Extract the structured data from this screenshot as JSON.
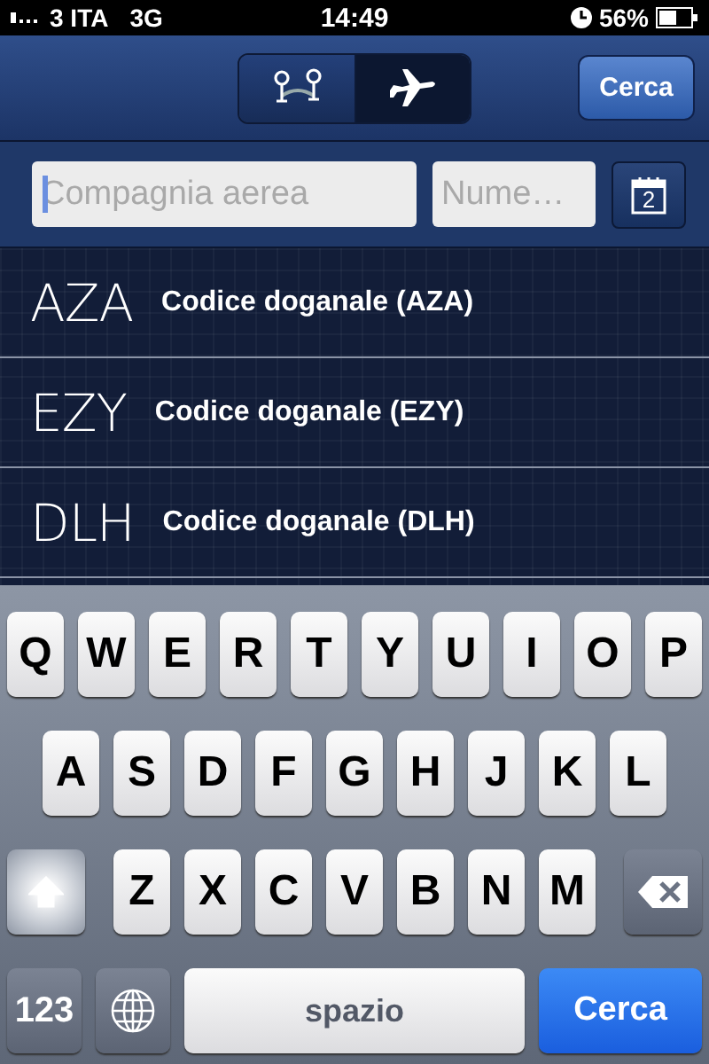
{
  "status_bar": {
    "carrier": "3 ITA",
    "network": "3G",
    "time": "14:49",
    "battery": "56%"
  },
  "nav_bar": {
    "segments": [
      {
        "kind": "route",
        "selected": false
      },
      {
        "kind": "plane",
        "selected": true
      }
    ],
    "search_button": "Cerca"
  },
  "search": {
    "airline_field": {
      "placeholder": "Compagnia aerea",
      "focused": true
    },
    "number_field": {
      "placeholder": "Nume…"
    },
    "calendar_day": "2"
  },
  "results": [
    {
      "code": "AZA",
      "description": "Codice doganale (AZA)"
    },
    {
      "code": "EZY",
      "description": "Codice doganale (EZY)"
    },
    {
      "code": "DLH",
      "description": "Codice doganale (DLH)"
    }
  ],
  "keyboard": {
    "letter_rows": [
      [
        "Q",
        "W",
        "E",
        "R",
        "T",
        "Y",
        "U",
        "I",
        "O",
        "P"
      ],
      [
        "A",
        "S",
        "D",
        "F",
        "G",
        "H",
        "J",
        "K",
        "L"
      ],
      [
        "Z",
        "X",
        "C",
        "V",
        "B",
        "N",
        "M"
      ]
    ],
    "shift_on": true,
    "numbers_key": "123",
    "space_key": "spazio",
    "action_key": "Cerca"
  }
}
